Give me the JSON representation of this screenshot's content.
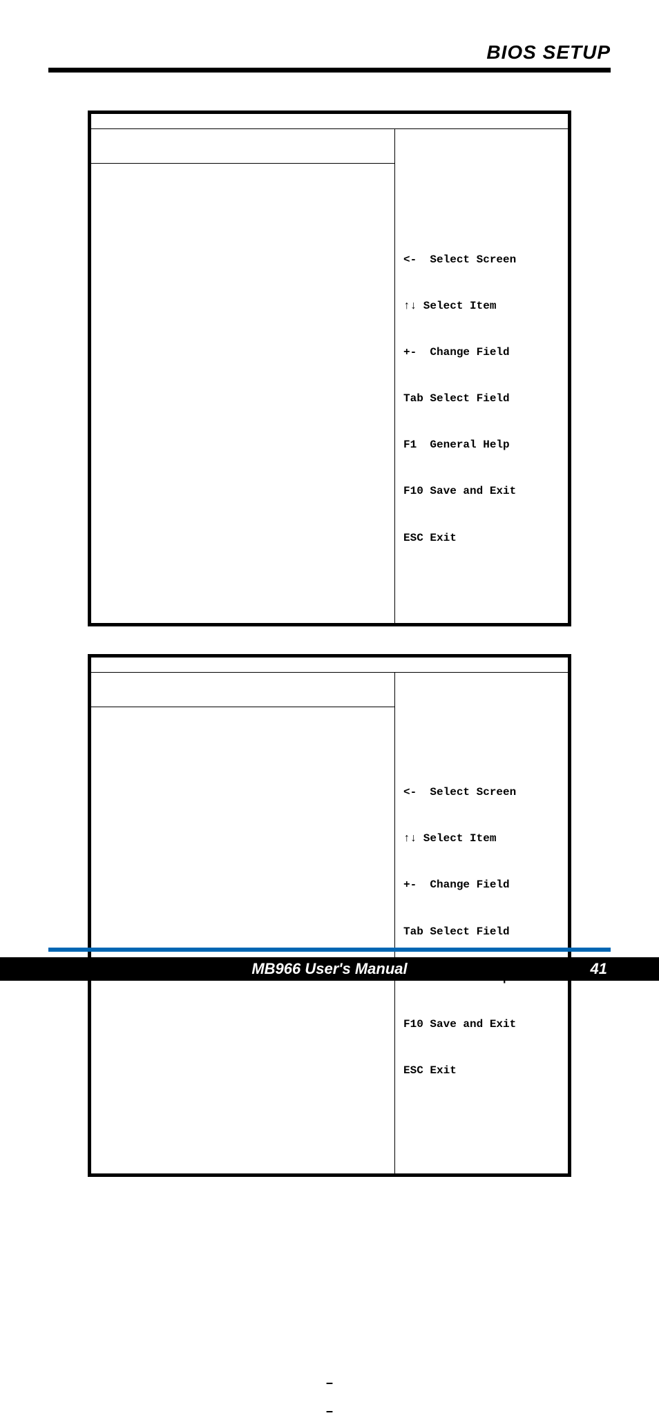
{
  "header": {
    "title": "BIOS SETUP"
  },
  "panels": [
    {
      "help_lines": [
        "<-  Select Screen",
        "↑↓ Select Item",
        "+-  Change Field",
        "Tab Select Field",
        "F1  General Help",
        "F10 Save and Exit",
        "ESC Exit"
      ]
    },
    {
      "help_lines": [
        "<-  Select Screen",
        "↑↓ Select Item",
        "+-  Change Field",
        "Tab Select Field",
        "F1  General Help",
        "F10 Save and Exit",
        "ESC Exit"
      ]
    }
  ],
  "dashes": [
    "–",
    "–"
  ],
  "footer": {
    "left": "MB966 User's Manual",
    "right": "41"
  }
}
